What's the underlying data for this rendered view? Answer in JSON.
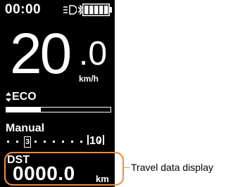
{
  "status": {
    "time": "00:00",
    "icons": [
      "headlight-icon",
      "bluetooth-icon",
      "battery-icon"
    ],
    "battery_level": 1.0
  },
  "speed": {
    "integer": "20",
    "decimal": ".0",
    "unit": "km/h"
  },
  "assist": {
    "mode": "ECO",
    "mode_icon": "up-down-arrows-icon",
    "level": 0.33
  },
  "shift": {
    "mode": "Manual",
    "gear_marker": "3",
    "current_gear": "10",
    "total_positions": 11
  },
  "travel": {
    "label": "DST",
    "value": "0000.0",
    "unit": "km"
  },
  "callout": {
    "text": "Travel data display",
    "color": "#f08a3c"
  }
}
